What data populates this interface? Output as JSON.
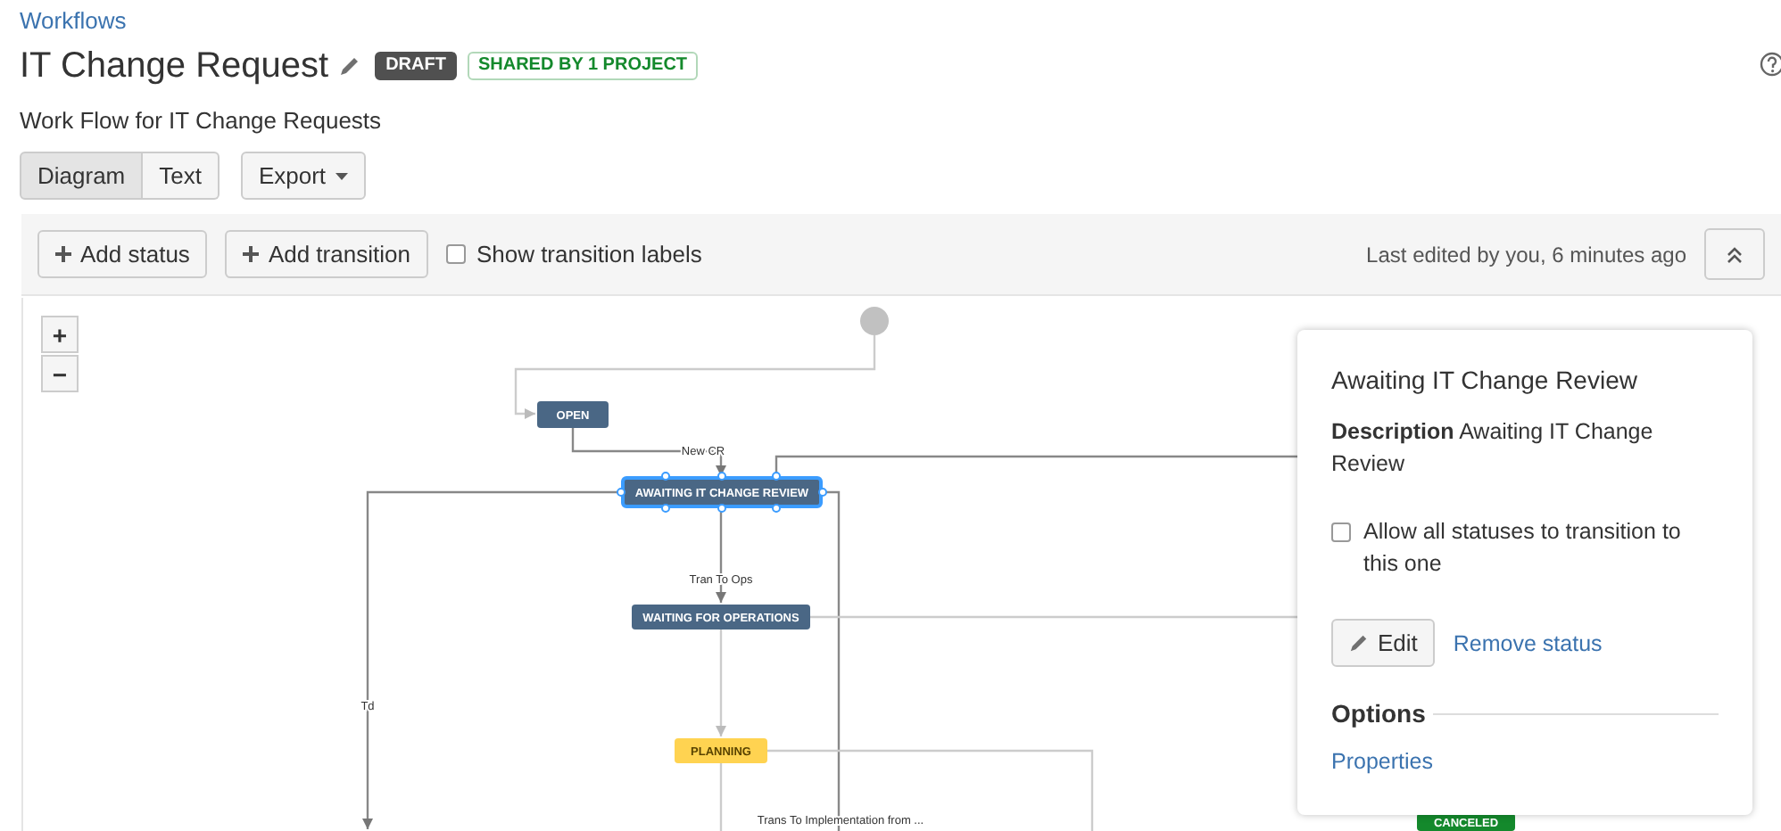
{
  "breadcrumb": "Workflows",
  "title": "IT Change Request",
  "badges": [
    {
      "label": "DRAFT",
      "kind": "draft"
    },
    {
      "label": "SHARED BY 1 PROJECT",
      "kind": "shared"
    }
  ],
  "description": "Work Flow for IT Change Requests",
  "view_tabs": [
    {
      "label": "Diagram",
      "selected": true
    },
    {
      "label": "Text",
      "selected": false
    }
  ],
  "export_button": "Export",
  "toolbar": {
    "add_status": "Add status",
    "add_transition": "Add transition",
    "show_labels": {
      "label": "Show transition labels",
      "checked": false
    },
    "last_edited": "Last edited by you, 6 minutes ago"
  },
  "zoom": [
    "+",
    "−"
  ],
  "statuses": [
    {
      "name": "OPEN",
      "kind": "todo",
      "selected": false
    },
    {
      "name": "AWAITING IT CHANGE REVIEW",
      "kind": "todo",
      "selected": true
    },
    {
      "name": "WAITING FOR OPERATIONS",
      "kind": "todo",
      "selected": false
    },
    {
      "name": "PLANNING",
      "kind": "inprogress",
      "selected": false
    },
    {
      "name": "CANCELED",
      "kind": "done",
      "selected": false
    }
  ],
  "transition_labels": [
    "New CR",
    "Td",
    "Tran To Ops",
    "Trans To Implementation from ..."
  ],
  "panel": {
    "title": "Awaiting IT Change Review",
    "description_label": "Description",
    "description": "Awaiting IT Change Review",
    "allow_all": {
      "label": "Allow all statuses to transition to this one",
      "checked": false
    },
    "edit_button": "Edit",
    "remove_link": "Remove status",
    "options_heading": "Options",
    "properties_link": "Properties"
  }
}
